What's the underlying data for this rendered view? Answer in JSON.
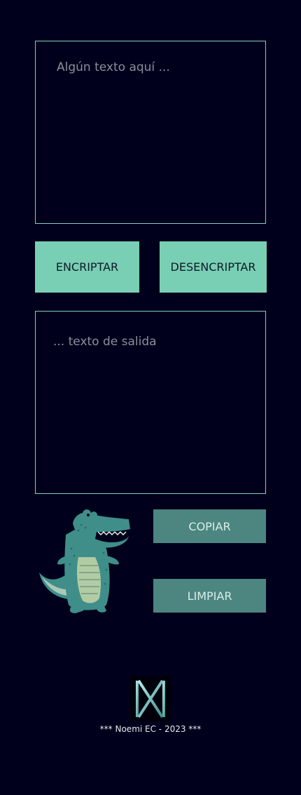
{
  "input": {
    "placeholder": "Algún texto aquí ..."
  },
  "actions": {
    "encrypt_label": "ENCRIPTAR",
    "decrypt_label": "DESENCRIPTAR",
    "copy_label": "COPIAR",
    "clear_label": "LIMPIAR"
  },
  "output": {
    "placeholder": "... texto de salida"
  },
  "footer": {
    "credit": "*** Noemi EC - 2023 ***"
  },
  "icons": {
    "mascot": "crocodile-illustration",
    "logo": "nx-monogram-logo"
  },
  "colors": {
    "background": "#00001c",
    "accent_mint": "#79cfb3",
    "accent_teal": "#4d8580",
    "border": "#7fcfc3"
  }
}
